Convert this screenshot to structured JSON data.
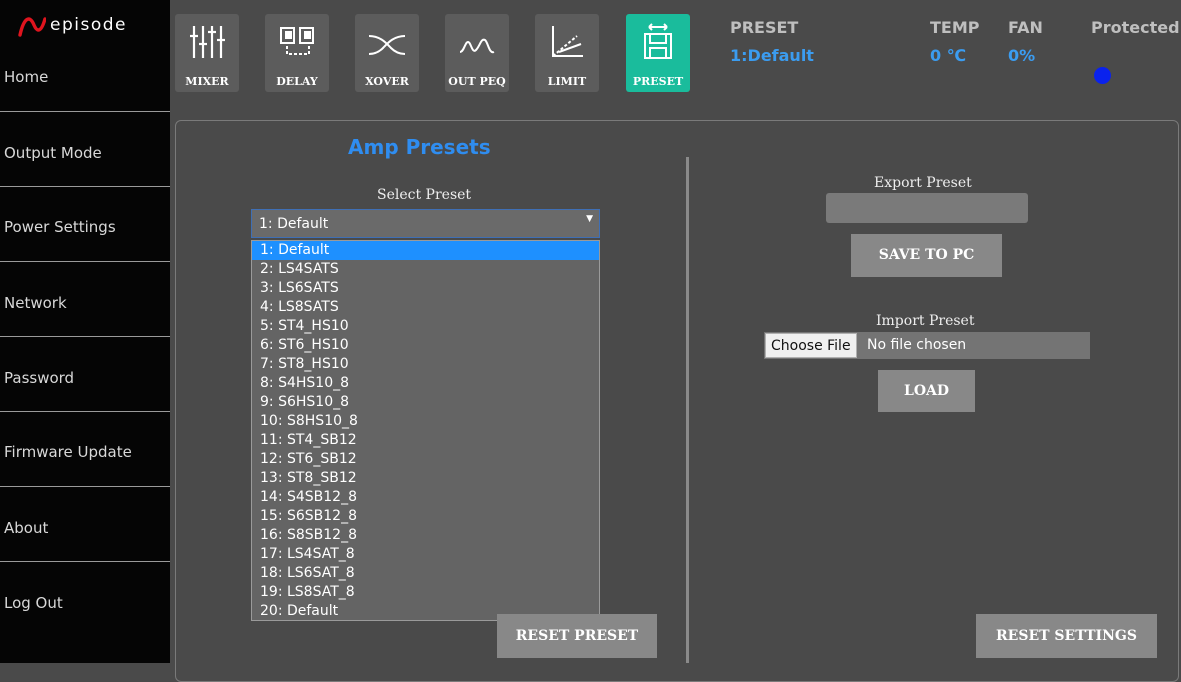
{
  "brand": {
    "name": "episode"
  },
  "sidebar": {
    "items": [
      {
        "label": "Home"
      },
      {
        "label": "Output Mode"
      },
      {
        "label": "Power Settings"
      },
      {
        "label": "Network"
      },
      {
        "label": "Password"
      },
      {
        "label": "Firmware Update"
      },
      {
        "label": "About"
      },
      {
        "label": "Log Out"
      }
    ]
  },
  "toolbar": {
    "tools": [
      {
        "label": "MIXER",
        "icon": "mixer-icon"
      },
      {
        "label": "DELAY",
        "icon": "delay-icon"
      },
      {
        "label": "XOVER",
        "icon": "xover-icon"
      },
      {
        "label": "OUT PEQ",
        "icon": "peq-icon"
      },
      {
        "label": "LIMIT",
        "icon": "limit-icon"
      },
      {
        "label": "PRESET",
        "icon": "preset-icon",
        "active": true
      }
    ],
    "active_color": "#1abc9c"
  },
  "status": {
    "preset_header": "PRESET",
    "preset_value": "1:Default",
    "temp_header": "TEMP",
    "temp_value": "0 ℃",
    "fan_header": "FAN",
    "fan_value": "0%",
    "protected_header": "Protected",
    "protected_indicator_color": "#0a22ee",
    "value_color": "#3b9cf0"
  },
  "panel": {
    "title": "Amp Presets",
    "select_label": "Select Preset",
    "selected": "1: Default",
    "options": [
      "1: Default",
      "2: LS4SATS",
      "3: LS6SATS",
      "4: LS8SATS",
      "5: ST4_HS10",
      "6: ST6_HS10",
      "7: ST8_HS10",
      "8: S4HS10_8",
      "9: S6HS10_8",
      "10: S8HS10_8",
      "11: ST4_SB12",
      "12: ST6_SB12",
      "13: ST8_SB12",
      "14: S4SB12_8",
      "15: S6SB12_8",
      "16: S8SB12_8",
      "17: LS4SAT_8",
      "18: LS6SAT_8",
      "19: LS8SAT_8",
      "20: Default"
    ],
    "reset_preset": "RESET PRESET",
    "export_label": "Export Preset",
    "export_value": "",
    "save_label": "SAVE TO PC",
    "import_label": "Import Preset",
    "choose_file": "Choose File",
    "file_status": "No file chosen",
    "load_label": "LOAD",
    "reset_settings": "RESET SETTINGS"
  }
}
